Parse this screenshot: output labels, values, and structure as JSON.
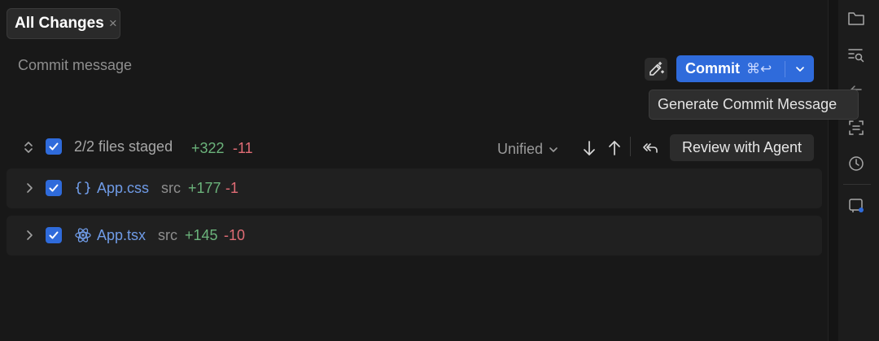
{
  "tab": {
    "label": "All Changes",
    "close_glyph": "×"
  },
  "commit": {
    "placeholder": "Commit message",
    "button_label": "Commit",
    "shortcut": "⌘↩",
    "generate_icon": "magic-pen-icon",
    "tooltip": "Generate Commit Message"
  },
  "staged": {
    "summary": "2/2 files staged",
    "additions": "+322",
    "deletions": "-11",
    "view_mode": "Unified",
    "review_button": "Review with Agent"
  },
  "files": [
    {
      "name": "App.css",
      "path": "src",
      "additions": "+177",
      "deletions": "-1",
      "icon": "css-braces-icon"
    },
    {
      "name": "App.tsx",
      "path": "src",
      "additions": "+145",
      "deletions": "-10",
      "icon": "react-icon"
    }
  ],
  "colors": {
    "accent": "#2f6bdb",
    "additions": "#6bb37b",
    "deletions": "#e06c75",
    "file_name": "#6f9be6"
  },
  "rightbar_icons": [
    "folder-icon",
    "search-list-icon",
    "arrow-left-icon",
    "scan-icon",
    "history-icon",
    "notification-icon"
  ]
}
